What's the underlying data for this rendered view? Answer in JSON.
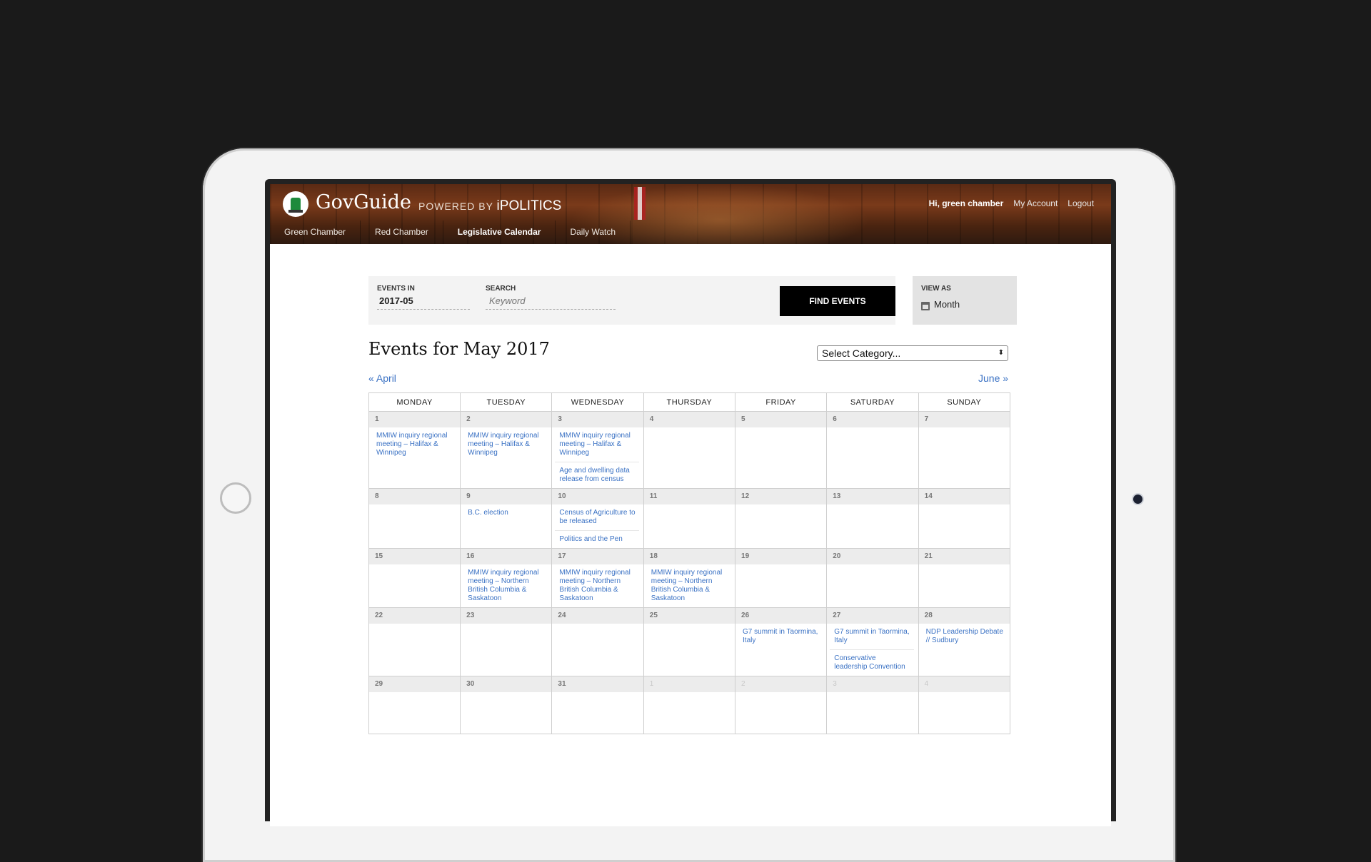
{
  "header": {
    "brand": "GovGuide",
    "powered_by": "POWERED BY",
    "powered_brand": "iPOLITICS",
    "greeting": "Hi, green chamber",
    "my_account": "My Account",
    "logout": "Logout"
  },
  "nav": {
    "tabs": [
      {
        "label": "Green Chamber"
      },
      {
        "label": "Red Chamber"
      },
      {
        "label": "Legislative Calendar"
      },
      {
        "label": "Daily Watch"
      }
    ],
    "active_tab": "Legislative Calendar"
  },
  "filter": {
    "events_in_label": "EVENTS IN",
    "events_in_value": "2017-05",
    "search_label": "SEARCH",
    "search_placeholder": "Keyword",
    "find_button": "FIND EVENTS",
    "view_as_label": "VIEW AS",
    "view_as_value": "Month"
  },
  "calendar": {
    "title": "Events for May 2017",
    "category_select": "Select Category...",
    "prev_link": "« April",
    "next_link": "June »",
    "weekdays": [
      "MONDAY",
      "TUESDAY",
      "WEDNESDAY",
      "THURSDAY",
      "FRIDAY",
      "SATURDAY",
      "SUNDAY"
    ],
    "weeks": [
      [
        {
          "day": "1",
          "events": [
            "MMIW inquiry regional meeting – Halifax & Winnipeg"
          ]
        },
        {
          "day": "2",
          "events": [
            "MMIW inquiry regional meeting – Halifax & Winnipeg"
          ]
        },
        {
          "day": "3",
          "events": [
            "MMIW inquiry regional meeting – Halifax & Winnipeg",
            "Age and dwelling data release from census"
          ]
        },
        {
          "day": "4",
          "events": []
        },
        {
          "day": "5",
          "events": []
        },
        {
          "day": "6",
          "events": []
        },
        {
          "day": "7",
          "events": []
        }
      ],
      [
        {
          "day": "8",
          "events": []
        },
        {
          "day": "9",
          "events": [
            "B.C. election"
          ]
        },
        {
          "day": "10",
          "events": [
            "Census of Agriculture to be released",
            "Politics and the Pen"
          ]
        },
        {
          "day": "11",
          "events": []
        },
        {
          "day": "12",
          "events": []
        },
        {
          "day": "13",
          "events": []
        },
        {
          "day": "14",
          "events": []
        }
      ],
      [
        {
          "day": "15",
          "events": []
        },
        {
          "day": "16",
          "events": [
            "MMIW inquiry regional meeting – Northern British Columbia & Saskatoon"
          ]
        },
        {
          "day": "17",
          "events": [
            "MMIW inquiry regional meeting – Northern British Columbia & Saskatoon"
          ]
        },
        {
          "day": "18",
          "events": [
            "MMIW inquiry regional meeting – Northern British Columbia & Saskatoon"
          ]
        },
        {
          "day": "19",
          "events": []
        },
        {
          "day": "20",
          "events": []
        },
        {
          "day": "21",
          "events": []
        }
      ],
      [
        {
          "day": "22",
          "events": []
        },
        {
          "day": "23",
          "events": []
        },
        {
          "day": "24",
          "events": []
        },
        {
          "day": "25",
          "events": []
        },
        {
          "day": "26",
          "events": [
            "G7 summit in Taormina, Italy"
          ]
        },
        {
          "day": "27",
          "events": [
            "G7 summit in Taormina, Italy",
            "Conservative leadership Convention"
          ]
        },
        {
          "day": "28",
          "events": [
            "NDP Leadership Debate // Sudbury"
          ]
        }
      ],
      [
        {
          "day": "29",
          "events": []
        },
        {
          "day": "30",
          "events": []
        },
        {
          "day": "31",
          "events": []
        },
        {
          "day": "1",
          "events": [],
          "other_month": true
        },
        {
          "day": "2",
          "events": [],
          "other_month": true
        },
        {
          "day": "3",
          "events": [],
          "other_month": true
        },
        {
          "day": "4",
          "events": [],
          "other_month": true
        }
      ]
    ]
  }
}
